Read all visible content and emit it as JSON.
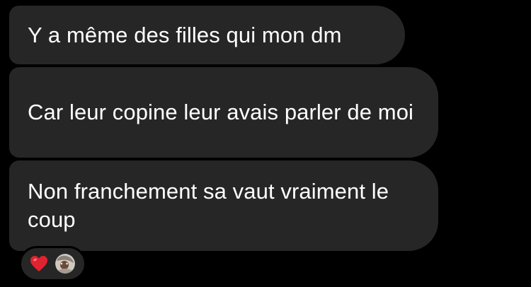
{
  "messages": [
    {
      "text": "Y a même des filles qui mon dm"
    },
    {
      "text": "Car leur copine leur avais parler de moi"
    },
    {
      "text": "Non franchement sa vaut vraiment le coup"
    }
  ],
  "reactions": {
    "emoji_icon": "red-heart-icon",
    "heart_color": "#e0232f",
    "bubble_color": "#262626",
    "background_color": "#000000"
  }
}
